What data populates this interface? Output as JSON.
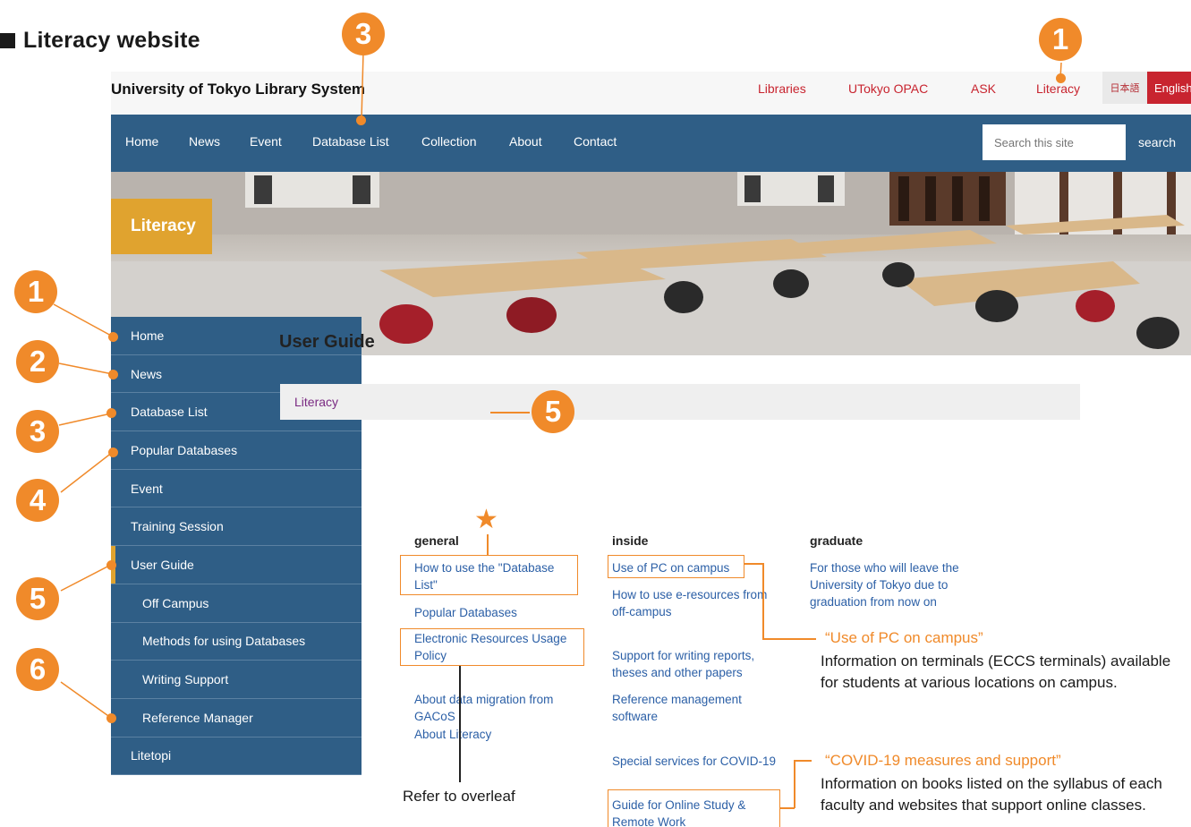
{
  "heading": "Literacy website",
  "site": {
    "title": "University of Tokyo Library System",
    "toplinks": [
      "Libraries",
      "UTokyo OPAC",
      "ASK",
      "Literacy"
    ],
    "lang_ja": "日本語",
    "lang_en": "English"
  },
  "nav": {
    "items": [
      "Home",
      "News",
      "Event",
      "Database List",
      "Collection",
      "About",
      "Contact"
    ],
    "search_placeholder": "Search this site",
    "search_button": "search"
  },
  "hero": {
    "badge": "Literacy"
  },
  "sidebar": {
    "items": [
      "Home",
      "News",
      "Database List",
      "Popular Databases",
      "Event",
      "Training Session",
      "User Guide",
      "Off Campus",
      "Methods for using Databases",
      "Writing Support",
      "Reference Manager",
      "Litetopi"
    ]
  },
  "main": {
    "title": "User Guide",
    "breadcrumb": "Literacy",
    "columns": {
      "general": {
        "heading": "general",
        "links": [
          "How to use the \"Database List\"",
          "Popular Databases",
          "Electronic Resources Usage Policy",
          "About data migration from GACoS",
          "About Literacy"
        ]
      },
      "inside": {
        "heading": "inside",
        "links": [
          "Use of PC on campus",
          "How to use e-resources from off-campus",
          "Support for writing reports, theses and other papers",
          "Reference management software",
          "Special services for COVID-19",
          "Guide for Online Study & Remote Work"
        ]
      },
      "graduate": {
        "heading": "graduate",
        "links": [
          "For those who will leave the University of Tokyo due to graduation from now on"
        ]
      }
    }
  },
  "annotations": {
    "badges": [
      "1",
      "3",
      "1",
      "2",
      "3",
      "4",
      "5",
      "6",
      "5"
    ],
    "pc_title": "“Use of PC on campus”",
    "pc_text": "Information on terminals (ECCS terminals) available for students at various locations on campus.",
    "covid_title": "“COVID-19 measures and support”",
    "covid_text": "Information on books listed on the syllabus of each faculty and websites that support online classes.",
    "overleaf": "Refer to overleaf",
    "star": "★"
  },
  "colors": {
    "accent": "#f08a2a",
    "nav": "#2f5e86",
    "brand_red": "#c8242f",
    "hero_badge": "#e0a32f"
  }
}
